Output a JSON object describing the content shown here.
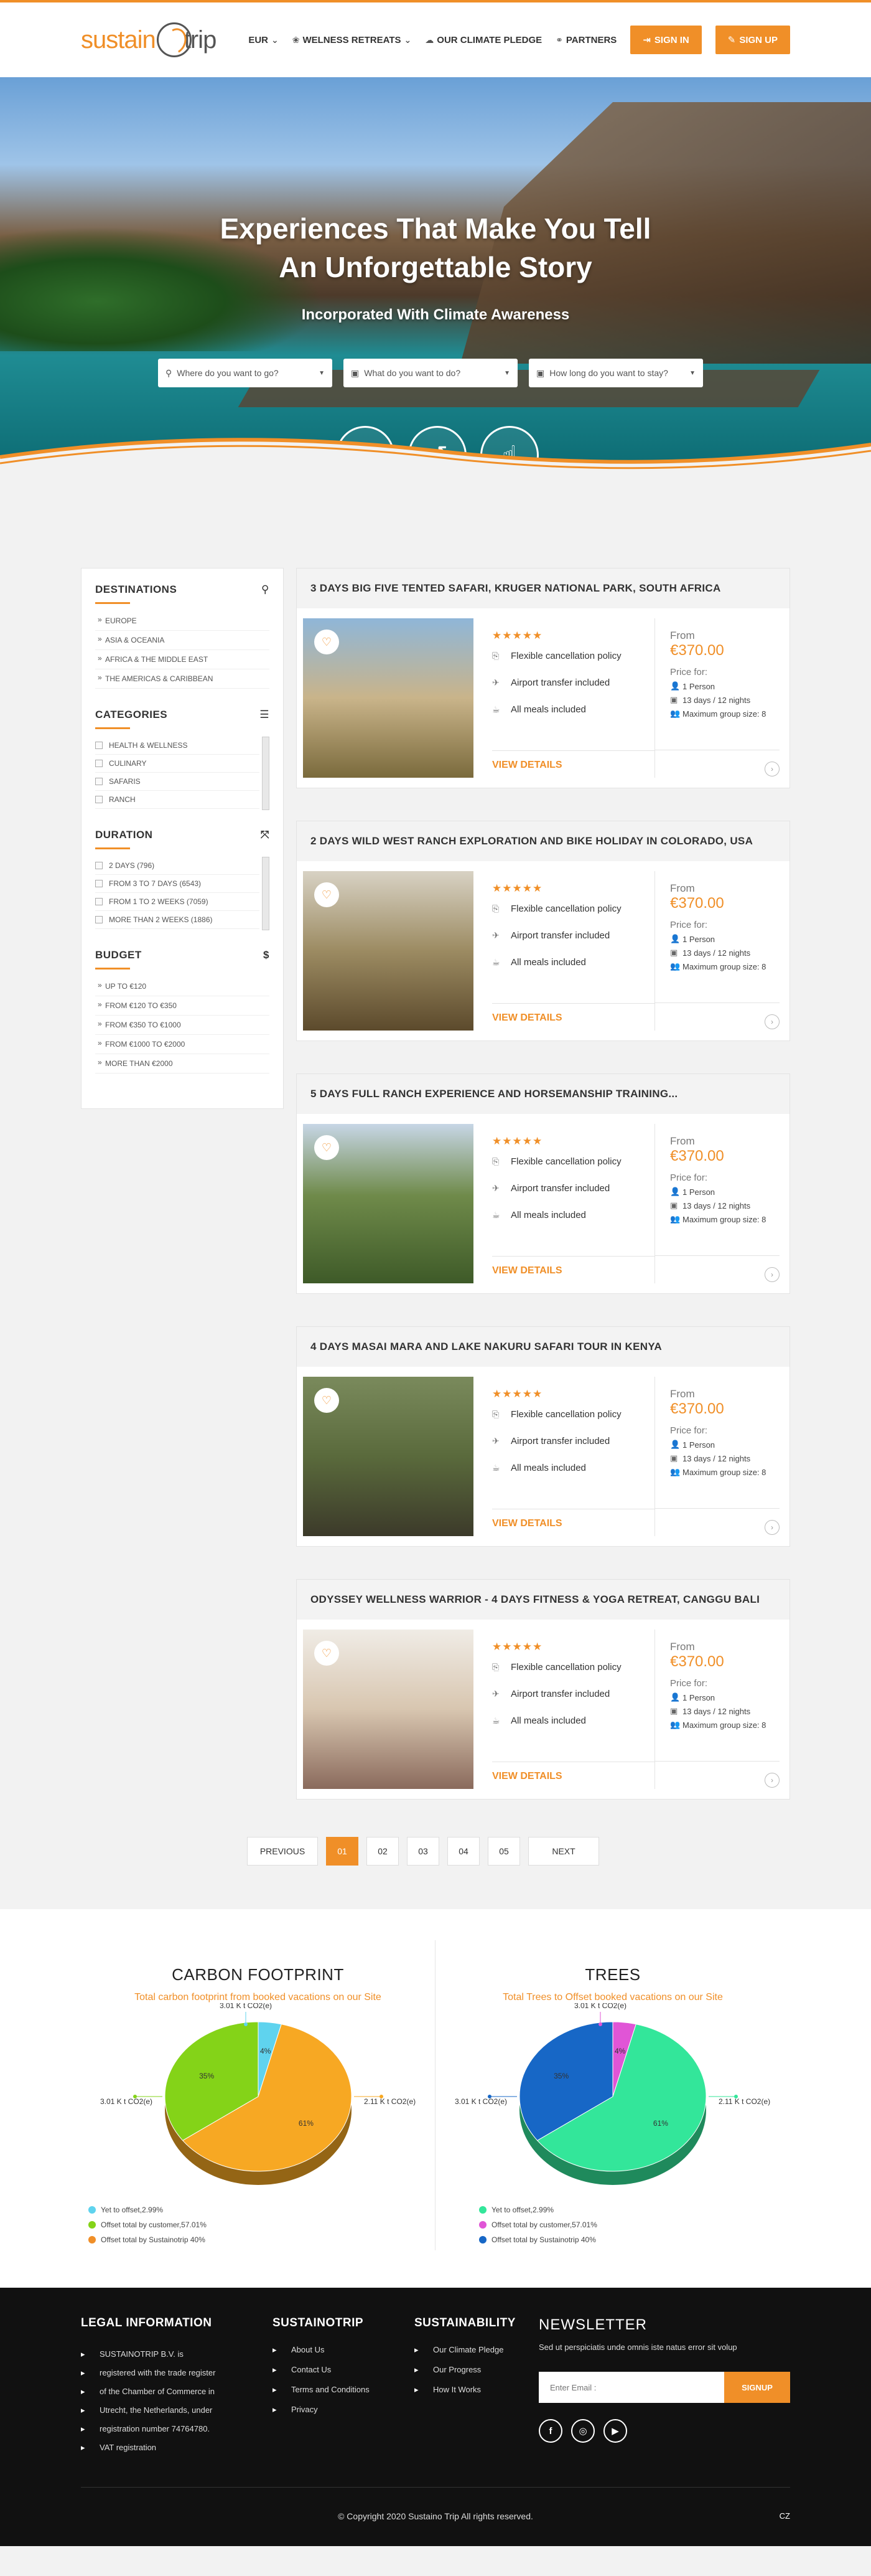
{
  "header": {
    "logo_left": "sustain",
    "logo_right": "trip",
    "nav": [
      {
        "label": "EUR",
        "icon": "chevron-down-icon",
        "glyph": "⌄"
      },
      {
        "label": "WELNESS RETREATS",
        "icon": "lotus-icon",
        "glyph": "⌄"
      },
      {
        "label": "OUR CLIMATE PLEDGE",
        "icon": "cloud-icon",
        "glyph": ""
      },
      {
        "label": "PARTNERS",
        "icon": "handshake-icon",
        "glyph": ""
      }
    ],
    "sign_in": "SIGN IN",
    "sign_up": "SIGN UP"
  },
  "hero": {
    "title_line1": "Experiences That Make You Tell",
    "title_line2": "An Unforgettable Story",
    "subtitle": "Incorporated With Climate Awareness",
    "search": [
      {
        "placeholder": "Where do you want to go?",
        "icon": "map-pin-icon"
      },
      {
        "placeholder": "What do you want to do?",
        "icon": "calendar-icon"
      },
      {
        "placeholder": "How long do you want to stay?",
        "icon": "calendar-icon"
      }
    ]
  },
  "sidebar": {
    "destinations": {
      "title": "DESTINATIONS",
      "items": [
        "EUROPE",
        "ASIA & OCEANIA",
        "AFRICA & THE MIDDLE EAST",
        "THE AMERICAS & CARIBBEAN"
      ]
    },
    "categories": {
      "title": "CATEGORIES",
      "items": [
        "HEALTH & WELLNESS",
        "CULINARY",
        "SAFARIS",
        "RANCH"
      ]
    },
    "duration": {
      "title": "DURATION",
      "items": [
        "2 DAYS (796)",
        "FROM 3 TO 7 DAYS (6543)",
        "FROM 1 TO 2 WEEKS (7059)",
        "MORE THAN 2 WEEKS (1886)"
      ]
    },
    "budget": {
      "title": "BUDGET",
      "icon_text": "$",
      "items": [
        "UP TO €120",
        "FROM €120 TO €350",
        "FROM €350 TO €1000",
        "FROM €1000 TO €2000",
        "MORE THAN €2000"
      ]
    }
  },
  "listings": [
    {
      "title": "3 DAYS BIG FIVE TENTED SAFARI, KRUGER NATIONAL PARK, SOUTH AFRICA",
      "stars": "★★★★★",
      "features": [
        "Flexible cancellation policy",
        "Airport transfer included",
        "All meals included"
      ],
      "view": "VIEW DETAILS",
      "from": "From",
      "price": "€370.00",
      "price_for": "Price for:",
      "people": "1 Person",
      "duration": "13 days / 12 nights",
      "group": "Maximum group size: 8"
    },
    {
      "title": "2 DAYS WILD WEST RANCH EXPLORATION AND BIKE HOLIDAY IN COLORADO, USA",
      "stars": "★★★★★",
      "features": [
        "Flexible cancellation policy",
        "Airport transfer included",
        "All meals included"
      ],
      "view": "VIEW DETAILS",
      "from": "From",
      "price": "€370.00",
      "price_for": "Price for:",
      "people": "1 Person",
      "duration": "13 days / 12 nights",
      "group": "Maximum group size: 8"
    },
    {
      "title": "5 DAYS FULL RANCH EXPERIENCE AND HORSEMANSHIP TRAINING...",
      "stars": "★★★★★",
      "features": [
        "Flexible cancellation policy",
        "Airport transfer included",
        "All meals included"
      ],
      "view": "VIEW DETAILS",
      "from": "From",
      "price": "€370.00",
      "price_for": "Price for:",
      "people": "1 Person",
      "duration": "13 days / 12 nights",
      "group": "Maximum group size: 8"
    },
    {
      "title": "4 DAYS MASAI MARA AND LAKE NAKURU SAFARI TOUR IN KENYA",
      "stars": "★★★★★",
      "features": [
        "Flexible cancellation policy",
        "Airport transfer included",
        "All meals included"
      ],
      "view": "VIEW DETAILS",
      "from": "From",
      "price": "€370.00",
      "price_for": "Price for:",
      "people": "1 Person",
      "duration": "13 days / 12 nights",
      "group": "Maximum group size: 8"
    },
    {
      "title": "ODYSSEY WELLNESS WARRIOR - 4 DAYS FITNESS & YOGA RETREAT, CANGGU BALI",
      "stars": "★★★★★",
      "features": [
        "Flexible cancellation policy",
        "Airport transfer included",
        "All meals included"
      ],
      "view": "VIEW DETAILS",
      "from": "From",
      "price": "€370.00",
      "price_for": "Price for:",
      "people": "1 Person",
      "duration": "13 days / 12 nights",
      "group": "Maximum group size: 8"
    }
  ],
  "pagination": {
    "previous": "PREVIOUS",
    "pages": [
      "01",
      "02",
      "03",
      "04",
      "05"
    ],
    "next": "NEXT"
  },
  "chart_data": [
    {
      "type": "pie",
      "title": "CARBON FOOTPRINT",
      "subtitle": "Total carbon footprint from booked vacations on our Site",
      "slices": [
        {
          "label": "Yet to offset,2.99%",
          "value": 4,
          "pct_label": "4%",
          "color": "#5fd3ee",
          "callout": "3.01 K t CO2(e)"
        },
        {
          "label": "Offset total by customer,57.01%",
          "value": 61,
          "pct_label": "61%",
          "color": "#f7a823",
          "callout": "2.11 K t CO2(e)"
        },
        {
          "label": "Offset total by Sustainotrip 40%",
          "value": 35,
          "pct_label": "35%",
          "color": "#84d318",
          "callout": "3.01 K t CO2(e)"
        }
      ],
      "legend": [
        {
          "label": "Yet to offset,2.99%",
          "color": "#5fd3ee"
        },
        {
          "label": "Offset total by customer,57.01%",
          "color": "#84d318"
        },
        {
          "label": "Offset total by Sustainotrip 40%",
          "color": "#f08f28"
        }
      ]
    },
    {
      "type": "pie",
      "title": "TREES",
      "subtitle": "Total Trees to Offset booked vacations on our Site",
      "slices": [
        {
          "label": "Yet to offset,2.99%",
          "value": 4,
          "pct_label": "4%",
          "color": "#e055d6",
          "callout": "3.01 K t CO2(e)"
        },
        {
          "label": "Offset total by customer,57.01%",
          "value": 61,
          "pct_label": "61%",
          "color": "#33e69a",
          "callout": "2.11 K t CO2(e)"
        },
        {
          "label": "Offset total by Sustainotrip 40%",
          "value": 35,
          "pct_label": "35%",
          "color": "#1767c6",
          "callout": "3.01 K t CO2(e)"
        }
      ],
      "legend": [
        {
          "label": "Yet to offset,2.99%",
          "color": "#33e69a"
        },
        {
          "label": "Offset total by customer,57.01%",
          "color": "#e055d6"
        },
        {
          "label": "Offset total by Sustainotrip 40%",
          "color": "#1767c6"
        }
      ]
    }
  ],
  "footer": {
    "legal": {
      "title": "LEGAL INFORMATION",
      "lines": [
        "SUSTAINOTRIP B.V. is",
        "registered with the trade register",
        "of the Chamber of Commerce in",
        "Utrecht, the Netherlands, under",
        "registration number 74764780.",
        "VAT registration"
      ]
    },
    "sustainotrip": {
      "title": "SUSTAINOTRIP",
      "links": [
        "About Us",
        "Contact Us",
        "Terms and Conditions",
        "Privacy"
      ]
    },
    "sustainability": {
      "title": "SUSTAINABILITY",
      "links": [
        "Our Climate Pledge",
        "Our Progress",
        "How It Works"
      ]
    },
    "newsletter": {
      "title": "NEWSLETTER",
      "text": "Sed ut perspiciatis unde omnis iste natus error sit volup",
      "placeholder": "Enter Email :",
      "button": "SIGNUP",
      "socials": [
        "f",
        "◎",
        "▶"
      ]
    },
    "copyright": "© Copyright 2020 Sustaino Trip All rights reserved.",
    "lang": "CZ"
  },
  "colors": {
    "accent": "#f08f28"
  }
}
